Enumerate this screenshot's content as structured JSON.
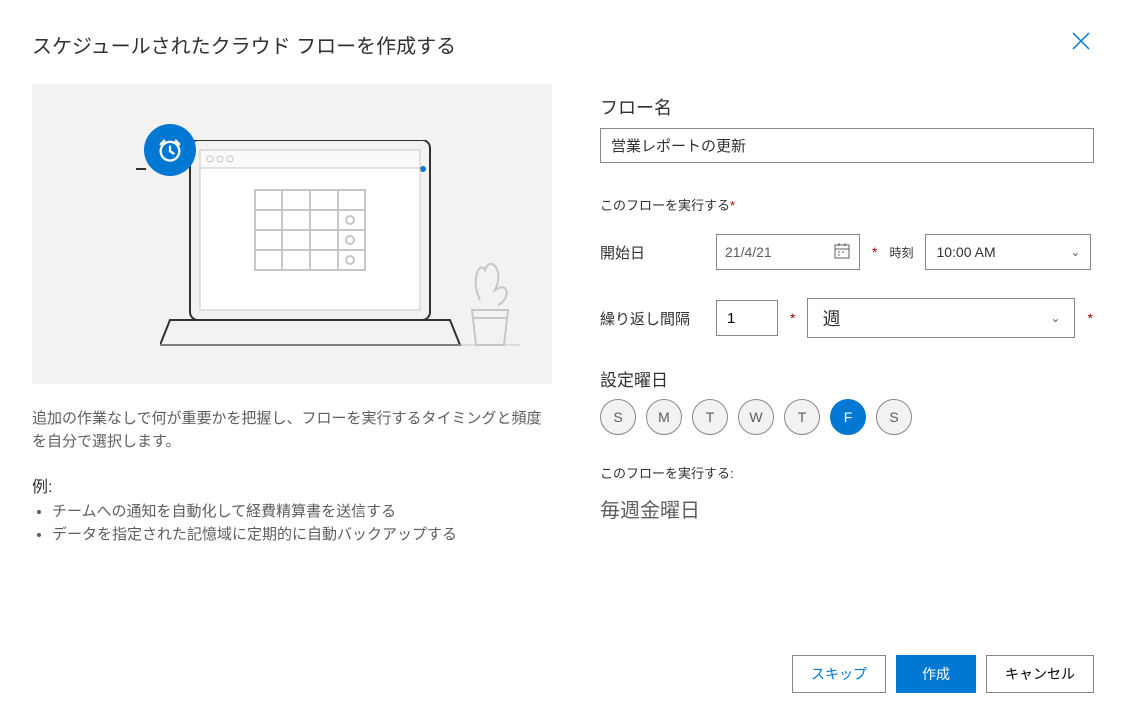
{
  "dialog": {
    "title": "スケジュールされたクラウド フローを作成する"
  },
  "left": {
    "description": "追加の作業なしで何が重要かを把握し、フローを実行するタイミングと頻度を自分で選択します。",
    "examples_label": "例:",
    "examples": [
      "チームへの通知を自動化して経費精算書を送信する",
      "データを指定された記憶域に定期的に自動バックアップする"
    ]
  },
  "form": {
    "flow_name_label": "フロー名",
    "flow_name_value": "営業レポートの更新",
    "run_heading": "このフローを実行する",
    "start_date_label": "開始日",
    "start_date_value": "21/4/21",
    "time_label": "時刻",
    "time_value": "10:00 AM",
    "repeat_label": "繰り返し間隔",
    "repeat_value": "1",
    "unit_value": "週",
    "days_label": "設定曜日",
    "days": [
      {
        "label": "S",
        "selected": false
      },
      {
        "label": "M",
        "selected": false
      },
      {
        "label": "T",
        "selected": false
      },
      {
        "label": "W",
        "selected": false
      },
      {
        "label": "T",
        "selected": false
      },
      {
        "label": "F",
        "selected": true
      },
      {
        "label": "S",
        "selected": false
      }
    ],
    "summary_label": "このフローを実行する:",
    "summary_value": "毎週金曜日"
  },
  "footer": {
    "skip": "スキップ",
    "create": "作成",
    "cancel": "キャンセル"
  }
}
